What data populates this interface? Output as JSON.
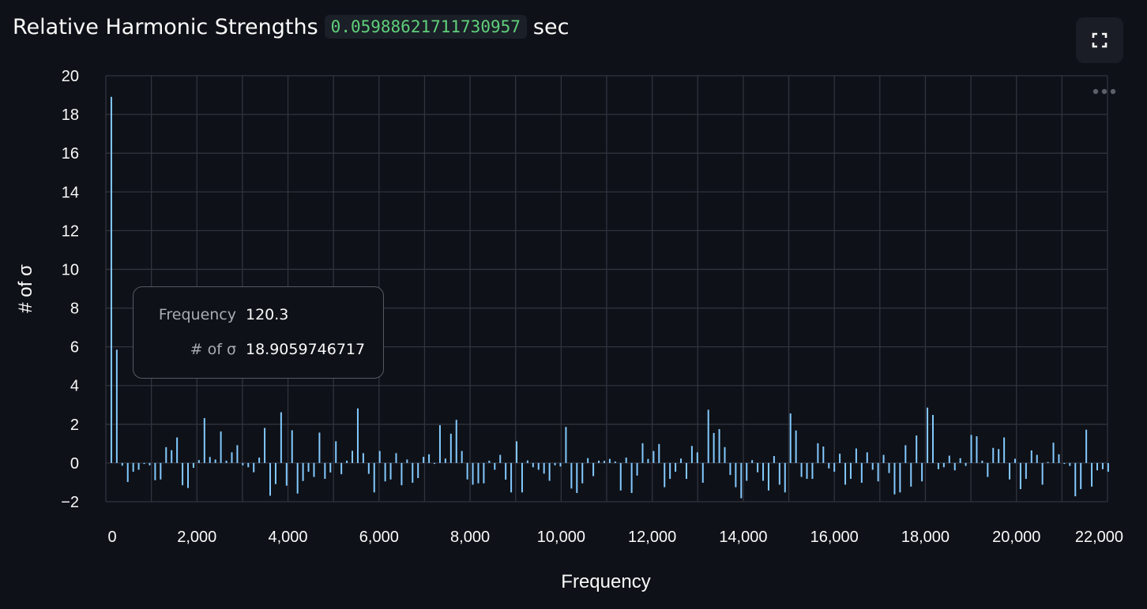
{
  "header": {
    "title_prefix": "Relative Harmonic Strengths",
    "time_value": "0.05988621711730957",
    "time_unit": "sec"
  },
  "toolbar": {
    "fullscreen_icon": "fullscreen-icon",
    "more_icon": "more-options-icon"
  },
  "colors": {
    "background": "#0e1117",
    "bar": "#83c9ff",
    "grid": "#31333f",
    "code_text": "#5fd07a"
  },
  "tooltip": {
    "rows": [
      {
        "label": "Frequency",
        "value": "120.3"
      },
      {
        "label": "# of σ",
        "value": "18.9059746717"
      }
    ]
  },
  "chart_data": {
    "type": "bar",
    "xlabel": "Frequency",
    "ylabel": "# of σ",
    "xlim": [
      0,
      22000
    ],
    "ylim": [
      -2,
      20
    ],
    "x_ticks": [
      0,
      2000,
      4000,
      6000,
      8000,
      10000,
      12000,
      14000,
      16000,
      18000,
      20000,
      22000
    ],
    "x_tick_labels": [
      "0",
      "2,000",
      "4,000",
      "6,000",
      "8,000",
      "10,000",
      "12,000",
      "14,000",
      "16,000",
      "18,000",
      "20,000",
      "22,000"
    ],
    "y_ticks": [
      -2,
      0,
      2,
      4,
      6,
      8,
      10,
      12,
      14,
      16,
      18,
      20
    ],
    "y_tick_labels": [
      "−2",
      "0",
      "2",
      "4",
      "6",
      "8",
      "10",
      "12",
      "14",
      "16",
      "18",
      "20"
    ],
    "x_gridlines": [
      0,
      1000,
      2000,
      3000,
      4000,
      5000,
      6000,
      7000,
      8000,
      9000,
      10000,
      11000,
      12000,
      13000,
      14000,
      15000,
      16000,
      17000,
      18000,
      19000,
      20000,
      21000,
      22000
    ],
    "y_gridlines": [
      -2,
      0,
      2,
      4,
      6,
      8,
      10,
      12,
      14,
      16,
      18,
      20
    ],
    "grid": true,
    "bar_spacing": 120.3,
    "values": [
      18.91,
      5.85,
      -0.14,
      -0.98,
      -0.45,
      -0.35,
      -0.05,
      -0.12,
      -0.89,
      -0.85,
      0.82,
      0.66,
      1.32,
      -1.15,
      -1.29,
      -0.25,
      0.15,
      2.32,
      0.31,
      0.18,
      1.63,
      0.12,
      0.55,
      0.92,
      -0.12,
      -0.22,
      -0.48,
      0.28,
      1.81,
      -1.69,
      -1.09,
      2.62,
      -1.17,
      1.69,
      -1.58,
      -0.93,
      -0.45,
      -0.72,
      1.57,
      -0.82,
      -0.49,
      1.12,
      -0.58,
      0.12,
      0.63,
      2.82,
      0.51,
      -0.56,
      -1.52,
      0.62,
      -0.95,
      -0.85,
      0.51,
      -1.15,
      0.18,
      -1.02,
      -0.78,
      0.32,
      0.45,
      -0.05,
      1.95,
      0.23,
      1.51,
      2.23,
      0.62,
      -0.85,
      -1.12,
      -1.05,
      -1.05,
      0.12,
      -0.35,
      0.42,
      -0.86,
      -1.52,
      1.12,
      -1.52,
      0.13,
      -0.22,
      -0.35,
      -0.55,
      -0.92,
      -0.12,
      -0.18,
      1.86,
      -1.32,
      -1.55,
      -1.05,
      0.25,
      -0.68,
      0.12,
      0.11,
      0.21,
      0.08,
      -1.42,
      0.28,
      -1.55,
      -0.65,
      1.02,
      0.21,
      0.62,
      0.98,
      -1.25,
      -0.82,
      -0.45,
      0.23,
      -0.82,
      0.88,
      0.55,
      -1.02,
      2.75,
      1.55,
      1.75,
      0.82,
      -0.62,
      -1.25,
      -1.82,
      -0.92,
      0.15,
      -0.48,
      -0.92,
      -1.42,
      0.36,
      -1.12,
      -1.52,
      2.56,
      1.68,
      -0.72,
      -0.82,
      -0.82,
      1.02,
      0.85,
      -0.28,
      -0.45,
      0.48,
      -1.12,
      -0.82,
      0.75,
      -1.02,
      0.55,
      -0.35,
      -0.95,
      0.42,
      -0.52,
      -1.62,
      -1.52,
      0.92,
      -1.22,
      1.42,
      -0.95,
      2.86,
      2.48,
      -0.32,
      -0.22,
      0.38,
      -0.38,
      0.25,
      -0.15,
      1.45,
      1.38,
      0.12,
      -0.72,
      0.78,
      0.72,
      1.32,
      -0.85,
      0.22,
      -1.35,
      -0.82,
      0.65,
      0.42,
      -1.12,
      0.05,
      1.05,
      0.45,
      -0.05,
      -0.15,
      -1.72,
      -1.35,
      1.72,
      -1.22,
      -0.38,
      -0.32,
      -0.45
    ]
  }
}
